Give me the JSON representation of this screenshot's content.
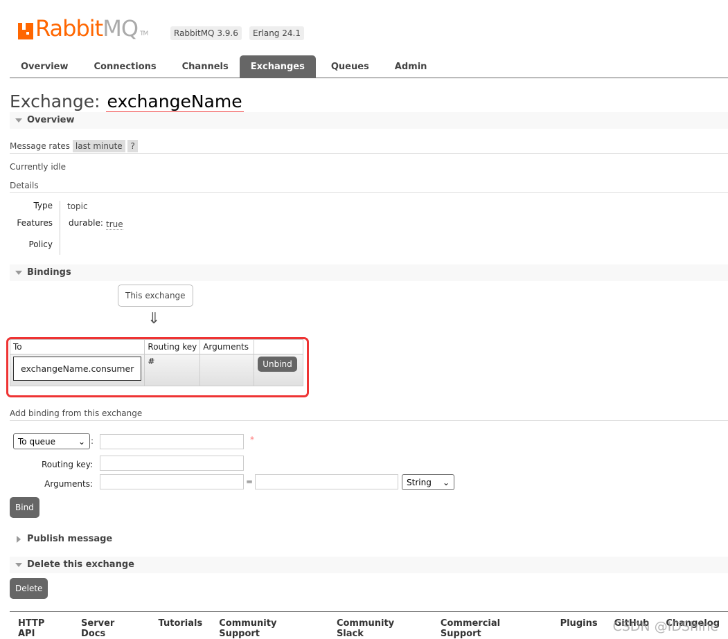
{
  "header": {
    "logo_text": "RabbitMQ",
    "logo_tm": "TM",
    "version": "RabbitMQ 3.9.6",
    "erlang": "Erlang 24.1"
  },
  "tabs": [
    {
      "label": "Overview"
    },
    {
      "label": "Connections"
    },
    {
      "label": "Channels"
    },
    {
      "label": "Exchanges",
      "active": true
    },
    {
      "label": "Queues"
    },
    {
      "label": "Admin"
    }
  ],
  "page": {
    "title_prefix": "Exchange:",
    "exchange_name": "exchangeName"
  },
  "overview": {
    "title": "Overview",
    "message_rates_label": "Message rates",
    "rate_option": "last minute",
    "help": "?",
    "status": "Currently idle",
    "details_label": "Details",
    "details": [
      {
        "key": "Type",
        "value": "topic"
      },
      {
        "key": "Features",
        "value": "durable:",
        "sub": "true"
      },
      {
        "key": "Policy",
        "value": ""
      }
    ]
  },
  "bindings": {
    "title": "Bindings",
    "this_exchange": "This exchange",
    "arrow": "⇓",
    "columns": [
      "To",
      "Routing key",
      "Arguments",
      ""
    ],
    "rows": [
      {
        "to": "exchangeName.consumer",
        "routing_key": "#",
        "arguments": "",
        "action": "Unbind"
      }
    ]
  },
  "add_binding": {
    "title": "Add binding from this exchange",
    "destination_type": "To queue",
    "required_mark": "*",
    "routing_key_label": "Routing key:",
    "arguments_label": "Arguments:",
    "equals": "=",
    "arg_type": "String",
    "bind_label": "Bind",
    "colon": ":"
  },
  "publish": {
    "title": "Publish message"
  },
  "delete": {
    "title": "Delete this exchange",
    "button": "Delete"
  },
  "footer": [
    "HTTP API",
    "Server Docs",
    "Tutorials",
    "Community Support",
    "Community Slack",
    "Commercial Support",
    "Plugins",
    "GitHub",
    "Changelog"
  ],
  "watermark": "CSDN @IDShine",
  "colors": {
    "accent": "#ff6600",
    "tab_active": "#666666",
    "highlight": "#e33333"
  }
}
